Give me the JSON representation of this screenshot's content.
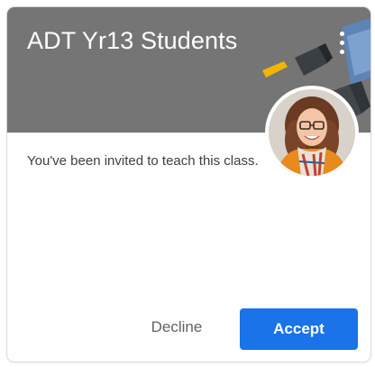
{
  "card": {
    "title": "ADT Yr13 Students",
    "message": "You've been invited to teach this class.",
    "more_icon": "more-vert-icon",
    "avatar_icon": "teacher-avatar"
  },
  "actions": {
    "decline_label": "Decline",
    "accept_label": "Accept"
  },
  "colors": {
    "header": "#757575",
    "accept": "#1a73e8",
    "decline_text": "#5f6368"
  }
}
